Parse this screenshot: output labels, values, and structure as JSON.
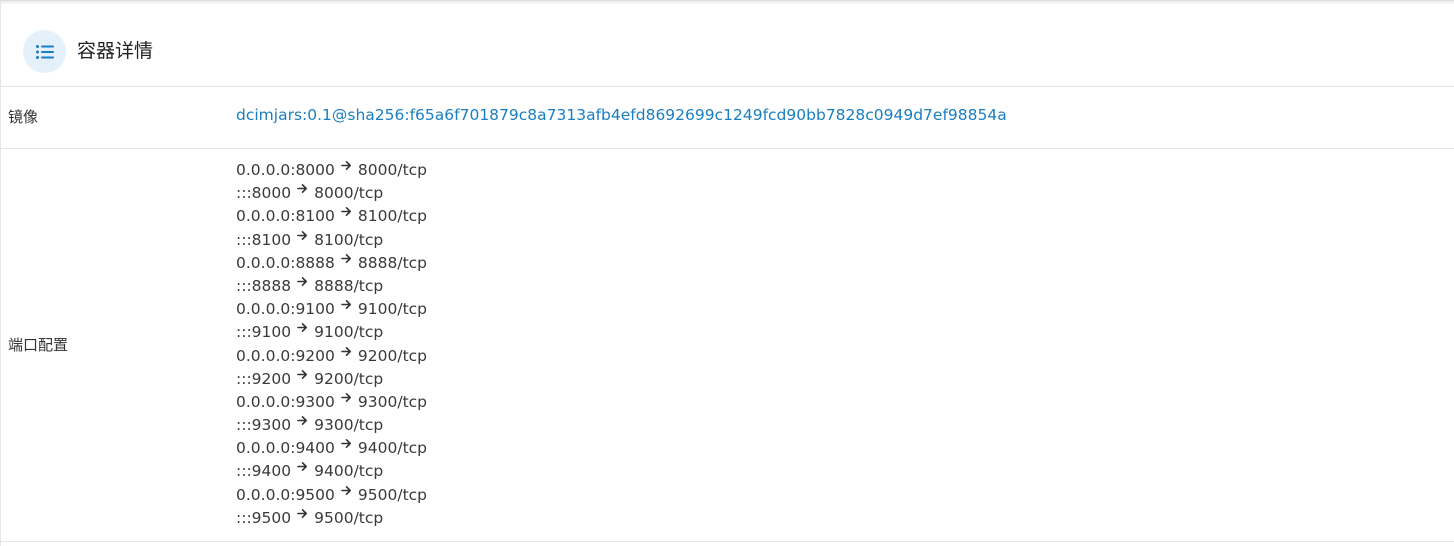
{
  "header": {
    "title": "容器详情",
    "icon": "list-icon"
  },
  "details": {
    "image": {
      "label": "镜像",
      "value": "dcimjars:0.1@sha256:f65a6f701879c8a7313afb4efd8692699c1249fcd90bb7828c0949d7ef98854a"
    },
    "ports": {
      "label": "端口配置",
      "arrow": "🡒",
      "mappings": [
        {
          "host": "0.0.0.0:8000",
          "container": "8000/tcp"
        },
        {
          "host": ":::8000",
          "container": "8000/tcp"
        },
        {
          "host": "0.0.0.0:8100",
          "container": "8100/tcp"
        },
        {
          "host": ":::8100",
          "container": "8100/tcp"
        },
        {
          "host": "0.0.0.0:8888",
          "container": "8888/tcp"
        },
        {
          "host": ":::8888",
          "container": "8888/tcp"
        },
        {
          "host": "0.0.0.0:9100",
          "container": "9100/tcp"
        },
        {
          "host": ":::9100",
          "container": "9100/tcp"
        },
        {
          "host": "0.0.0.0:9200",
          "container": "9200/tcp"
        },
        {
          "host": ":::9200",
          "container": "9200/tcp"
        },
        {
          "host": "0.0.0.0:9300",
          "container": "9300/tcp"
        },
        {
          "host": ":::9300",
          "container": "9300/tcp"
        },
        {
          "host": "0.0.0.0:9400",
          "container": "9400/tcp"
        },
        {
          "host": ":::9400",
          "container": "9400/tcp"
        },
        {
          "host": "0.0.0.0:9500",
          "container": "9500/tcp"
        },
        {
          "host": ":::9500",
          "container": "9500/tcp"
        }
      ]
    }
  },
  "colors": {
    "accent": "#1a7fc1",
    "icon_bg": "#e4f1fb"
  }
}
